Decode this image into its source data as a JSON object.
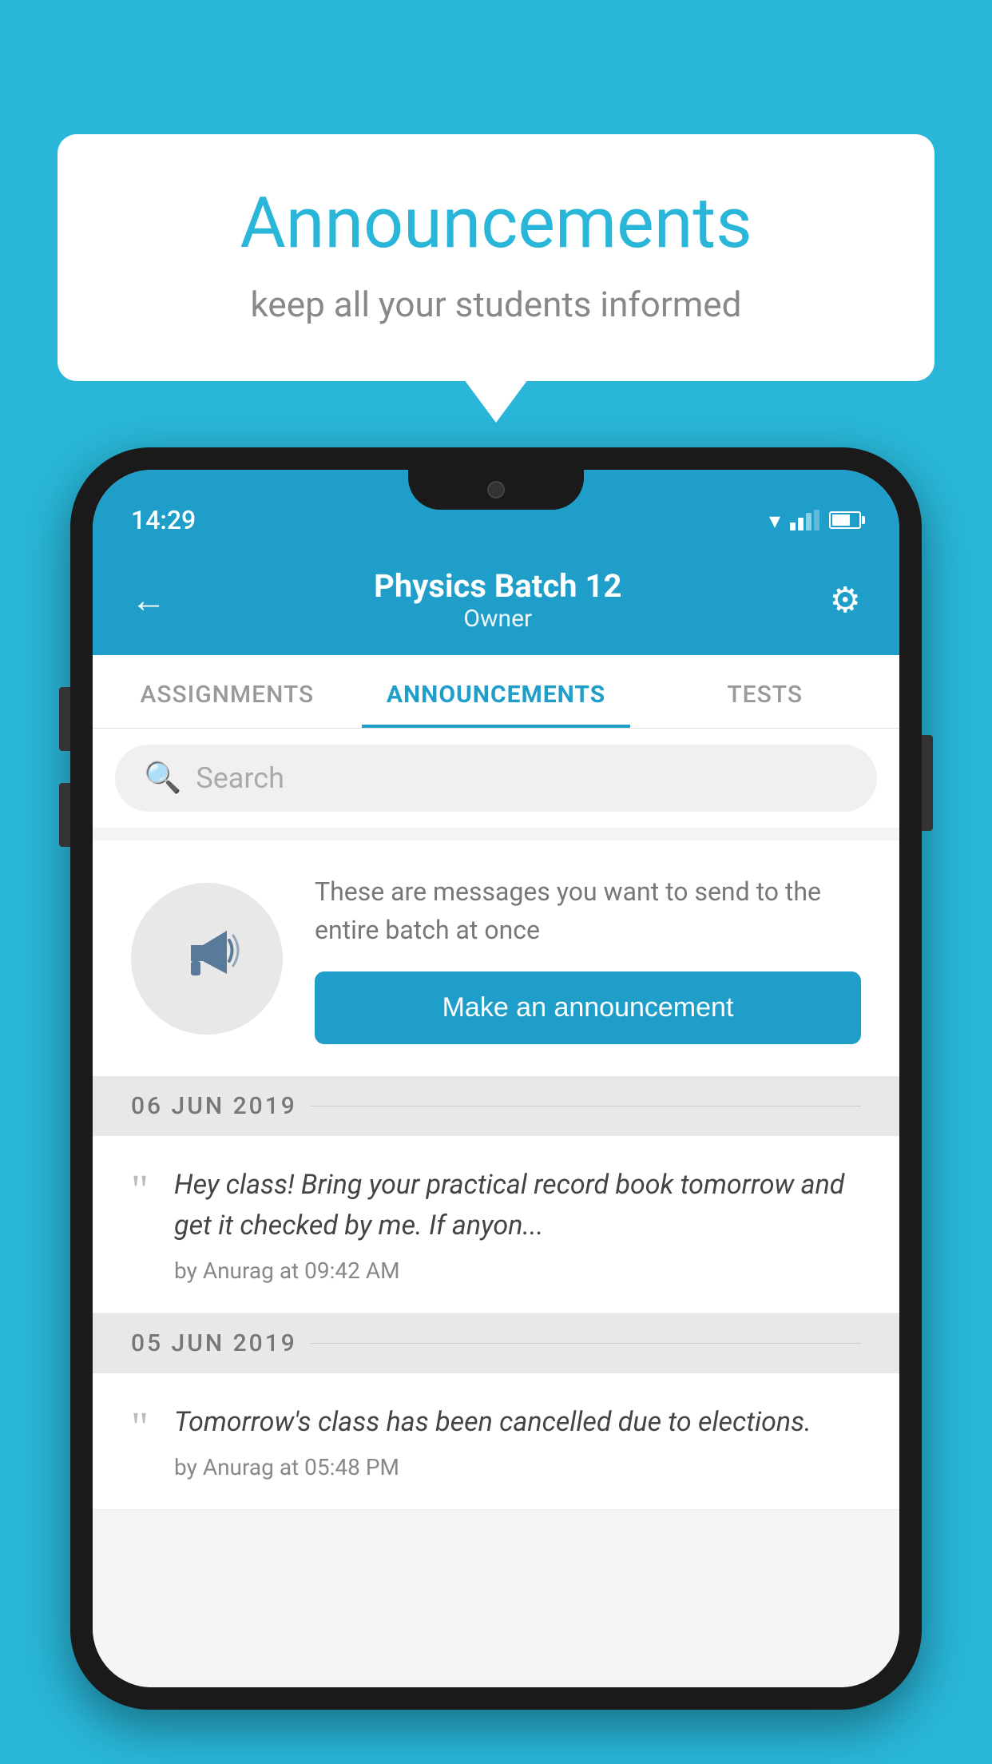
{
  "background_color": "#29b6d8",
  "speech_bubble": {
    "title": "Announcements",
    "subtitle": "keep all your students informed"
  },
  "status_bar": {
    "time": "14:29"
  },
  "app_header": {
    "title": "Physics Batch 12",
    "subtitle": "Owner",
    "back_label": "←",
    "settings_label": "⚙"
  },
  "tabs": [
    {
      "label": "ASSIGNMENTS",
      "active": false
    },
    {
      "label": "ANNOUNCEMENTS",
      "active": true
    },
    {
      "label": "TESTS",
      "active": false
    }
  ],
  "search": {
    "placeholder": "Search"
  },
  "promo": {
    "description": "These are messages you want to send to the entire batch at once",
    "button_label": "Make an announcement"
  },
  "announcements": [
    {
      "date": "06  JUN  2019",
      "text": "Hey class! Bring your practical record book tomorrow and get it checked by me. If anyon...",
      "meta": "by Anurag at 09:42 AM"
    },
    {
      "date": "05  JUN  2019",
      "text": "Tomorrow's class has been cancelled due to elections.",
      "meta": "by Anurag at 05:48 PM"
    }
  ]
}
